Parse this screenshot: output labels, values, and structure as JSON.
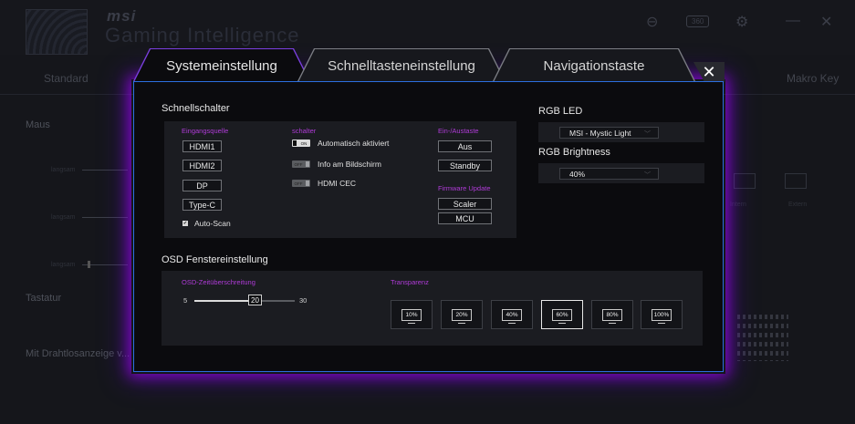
{
  "background": {
    "brand": "msi",
    "title": "Gaming Intelligence",
    "tabs": [
      "Standard",
      "Makro Key"
    ],
    "sections": [
      "Maus",
      "Tastatur",
      "Mit Drahtlosanzeige v..."
    ],
    "slider_labels": [
      "langsam",
      "langsam",
      "langsam"
    ],
    "right_labels": [
      "Intern",
      "Extern"
    ],
    "header_badge": "360"
  },
  "modal": {
    "tabs": [
      "Systemeinstellung",
      "Schnelltasteneinstellung",
      "Navigationstaste"
    ],
    "close": "✕",
    "quick_switch": {
      "title": "Schnellschalter",
      "input": {
        "heading": "Eingangsquelle",
        "items": [
          "HDMI1",
          "HDMI2",
          "DP",
          "Type-C"
        ],
        "autoscan": "Auto-Scan"
      },
      "switch": {
        "heading": "schalter",
        "items": [
          {
            "state": "ON",
            "label": "Automatisch aktiviert"
          },
          {
            "state": "OFF",
            "label": "Info am Bildschirm"
          },
          {
            "state": "OFF",
            "label": "HDMI CEC"
          }
        ]
      },
      "power": {
        "heading": "Ein-/Austaste",
        "items": [
          "Aus",
          "Standby"
        ]
      },
      "firmware": {
        "heading": "Firmware Update",
        "items": [
          "Scaler",
          "MCU"
        ]
      }
    },
    "rgb": {
      "led_title": "RGB LED",
      "led_value": "MSI - Mystic Light",
      "brightness_title": "RGB Brightness",
      "brightness_value": "40%"
    },
    "osd": {
      "title": "OSD Fenstereinstellung",
      "timeout": {
        "heading": "OSD-Zeitüberschreitung",
        "min": "5",
        "max": "30",
        "value": "20",
        "fraction": 0.6
      },
      "transparency": {
        "heading": "Transparenz",
        "options": [
          "10%",
          "20%",
          "40%",
          "60%",
          "80%",
          "100%"
        ],
        "selected": "60%"
      }
    }
  }
}
